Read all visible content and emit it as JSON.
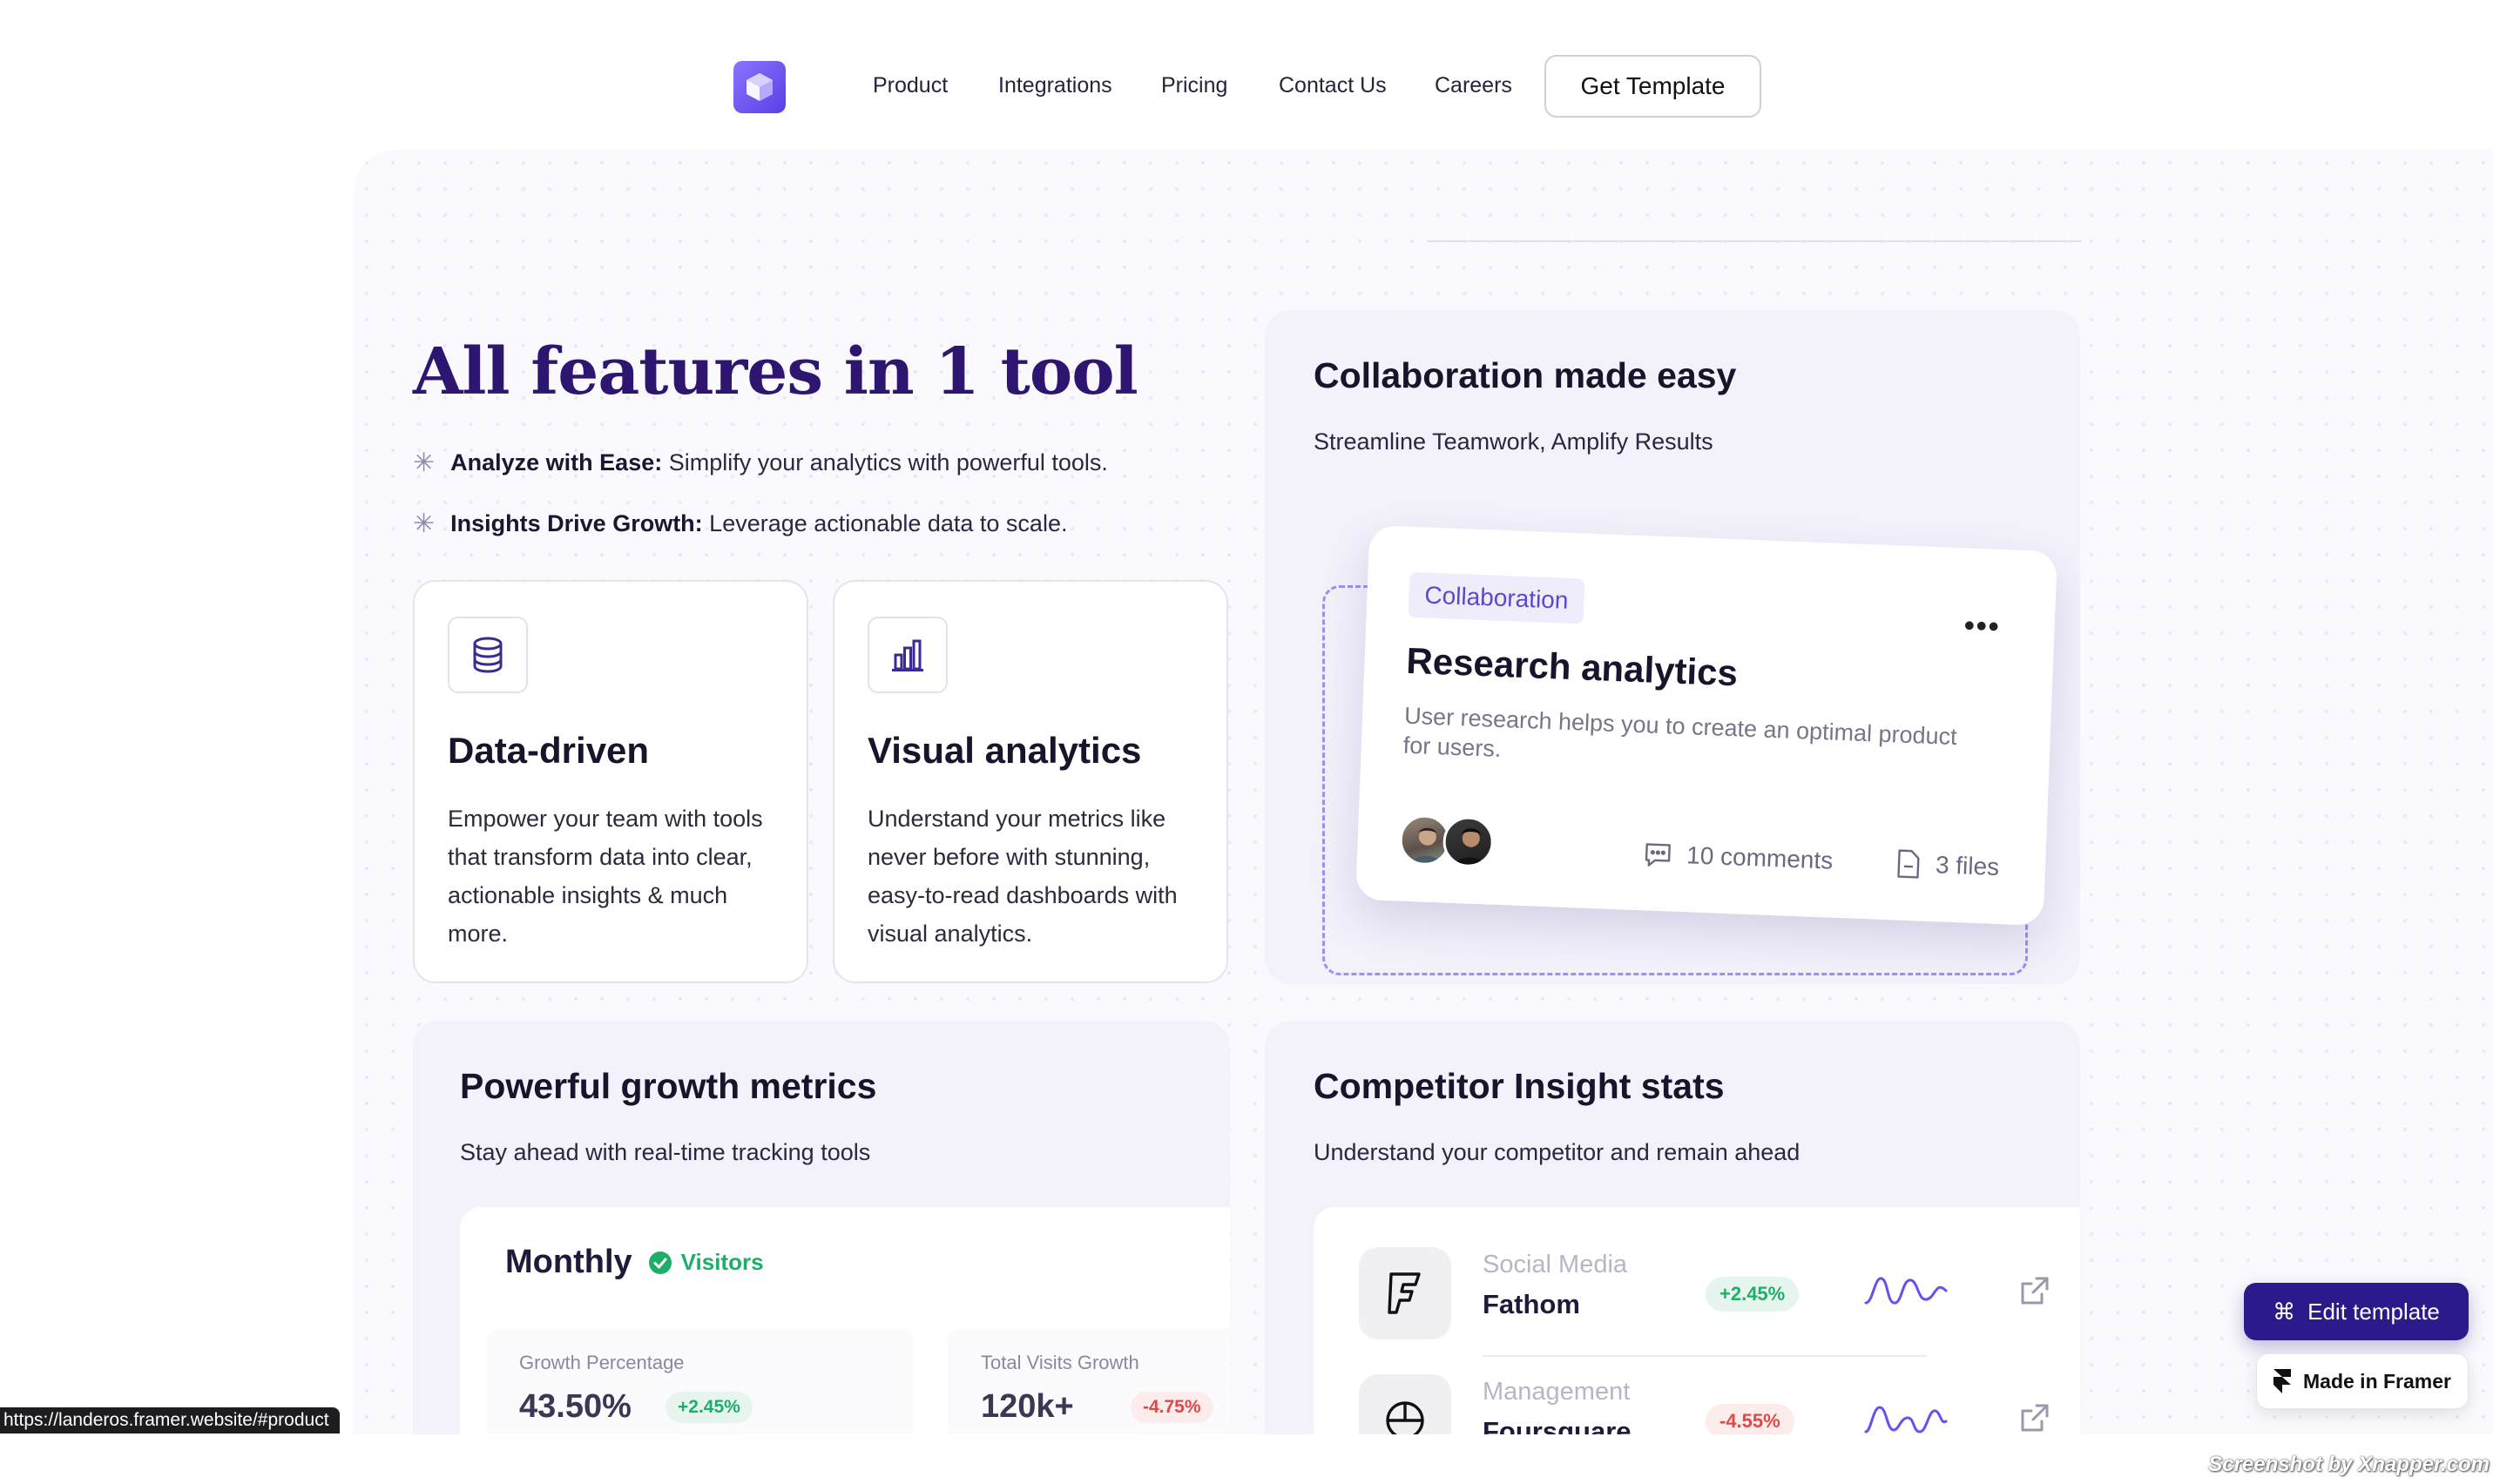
{
  "nav": {
    "links": [
      "Product",
      "Integrations",
      "Pricing",
      "Contact Us",
      "Careers"
    ],
    "cta": "Get Template"
  },
  "hero": {
    "title": "All features in 1 tool",
    "bullets": [
      {
        "bold": "Analyze with Ease:",
        "text": " Simplify your analytics with powerful tools."
      },
      {
        "bold": "Insights Drive Growth:",
        "text": " Leverage actionable data to scale."
      }
    ]
  },
  "features": [
    {
      "icon": "database-icon",
      "title": "Data-driven",
      "desc": "Empower your team with tools that transform data into clear, actionable insights & much more."
    },
    {
      "icon": "bar-chart-icon",
      "title": "Visual analytics",
      "desc": "Understand your metrics like never before with stunning, easy-to-read dashboards with visual analytics."
    }
  ],
  "collab": {
    "title": "Collaboration made easy",
    "subtitle": "Streamline Teamwork, Amplify Results",
    "card": {
      "tag": "Collaboration",
      "title": "Research analytics",
      "desc": "User research helps you to create an optimal product for users.",
      "comments": "10 comments",
      "files": "3 files"
    }
  },
  "growth": {
    "title": "Powerful growth metrics",
    "subtitle": "Stay ahead with real-time tracking tools",
    "panel_title": "Monthly",
    "panel_badge": "Visitors",
    "stats": [
      {
        "label": "Growth Percentage",
        "value": "43.50%",
        "change": "+2.45%"
      },
      {
        "label": "Total Visits Growth",
        "value": "120k+",
        "change": "-4.75%"
      }
    ]
  },
  "competitor": {
    "title": "Competitor Insight stats",
    "subtitle": "Understand your competitor and remain ahead",
    "rows": [
      {
        "category": "Social Media",
        "name": "Fathom",
        "change": "+2.45%"
      },
      {
        "category": "Management",
        "name": "Foursquare",
        "change": "-4.55%"
      }
    ]
  },
  "status_url": "https://landeros.framer.website/#product",
  "floating": {
    "edit": "Edit template",
    "framer": "Made in Framer"
  },
  "watermark": "Screenshot by Xnapper.com",
  "colors": {
    "accent": "#2d1570",
    "brand": "#6a4ff0",
    "positive": "#1fae6a",
    "negative": "#e04848"
  }
}
